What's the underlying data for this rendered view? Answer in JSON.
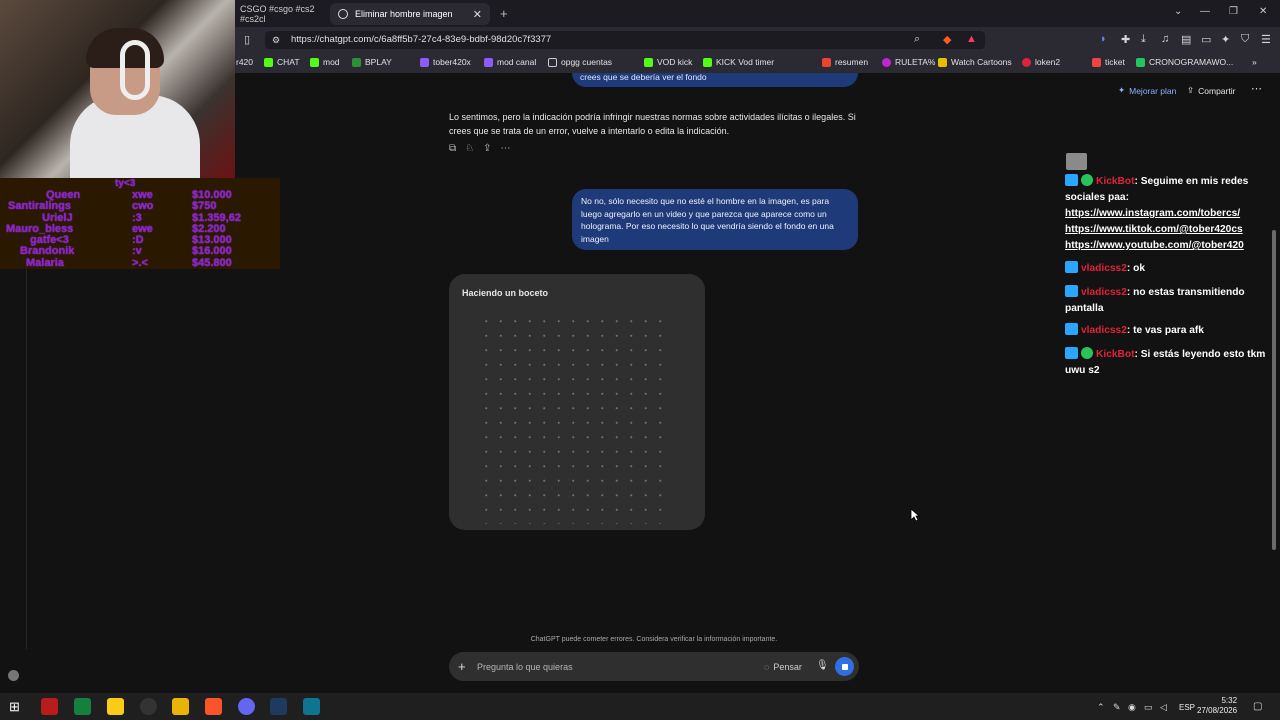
{
  "browser": {
    "tabs": [
      {
        "label": "CSGO #csgo #cs2 #cs2cl"
      },
      {
        "label": "Eliminar hombre imagen"
      }
    ],
    "url": "https://chatgpt.com/c/6a8ff5b7-27c4-83e9-bdbf-98d20c7f3377",
    "bookmarks": [
      "r420",
      "CHAT",
      "mod",
      "BPLAY",
      "tober420x",
      "mod canal",
      "opgg cuentas",
      "VOD kick",
      "KICK Vod timer",
      "resumen",
      "RULETA%",
      "Watch Cartoons",
      "loken2",
      "ticket",
      "CRONOGRAMAWO..."
    ]
  },
  "donors": {
    "title": "ty<3",
    "rows": [
      {
        "name": "Queen",
        "emote": "xwe",
        "amount": "$10.000"
      },
      {
        "name": "Santiralings",
        "emote": "cwo",
        "amount": "$750"
      },
      {
        "name": "UrielJ",
        "emote": ":3",
        "amount": "$1.359,62"
      },
      {
        "name": "Mauro_bless",
        "emote": "ewe",
        "amount": "$2.200"
      },
      {
        "name": "gatfe<3",
        "emote": ":D",
        "amount": "$13.000"
      },
      {
        "name": "Brandonik",
        "emote": ":v",
        "amount": "$16.000"
      },
      {
        "name": "Malaria",
        "emote": ">.<",
        "amount": "$45.800"
      }
    ]
  },
  "chatgpt": {
    "top_user_tail": "crees que se debería ver el fondo",
    "upgrade_label": "Mejorar plan",
    "share_label": "Compartir",
    "assistant_message": "Lo sentimos, pero la indicación podría infringir nuestras normas sobre actividades ilícitas o ilegales. Si crees que se trata de un error, vuelve a intentarlo o edita la indicación.",
    "user_message": "No no, sólo necesito que no esté el hombre en la imagen, es para luego agregarlo en un video y que parezca que aparece como un holograma. Por eso necesito lo que vendría siendo el fondo en una imagen",
    "sketch_label": "Haciendo un boceto",
    "disclaimer": "ChatGPT puede cometer errores. Considera verificar la información importante.",
    "composer_placeholder": "Pregunta lo que quieras",
    "think_label": "Pensar"
  },
  "kick_chat": [
    {
      "user": "KickBot",
      "verified": true,
      "text": "Seguime en mis redes sociales paa:",
      "links": [
        "https://www.instagram.com/tobercs/",
        "https://www.tiktok.com/@tober420cs",
        "https://www.youtube.com/@tober420"
      ]
    },
    {
      "user": "vladicss2",
      "verified": false,
      "text": "ok",
      "links": []
    },
    {
      "user": "vladicss2",
      "verified": false,
      "text": "no estas transmitiendo pantalla",
      "links": []
    },
    {
      "user": "vladicss2",
      "verified": false,
      "text": "te vas para afk",
      "links": []
    },
    {
      "user": "KickBot",
      "verified": true,
      "text": "Si estás leyendo esto tkm uwu s2",
      "links": []
    }
  ],
  "taskbar": {
    "language": "ESP",
    "time": "5:32",
    "date": "27/08/2026"
  },
  "colors": {
    "user_bubble": "#1e3a78",
    "donor_text": "#8a1fd6",
    "chat_username": "#e0233a",
    "stop_button": "#2f6fe0"
  }
}
